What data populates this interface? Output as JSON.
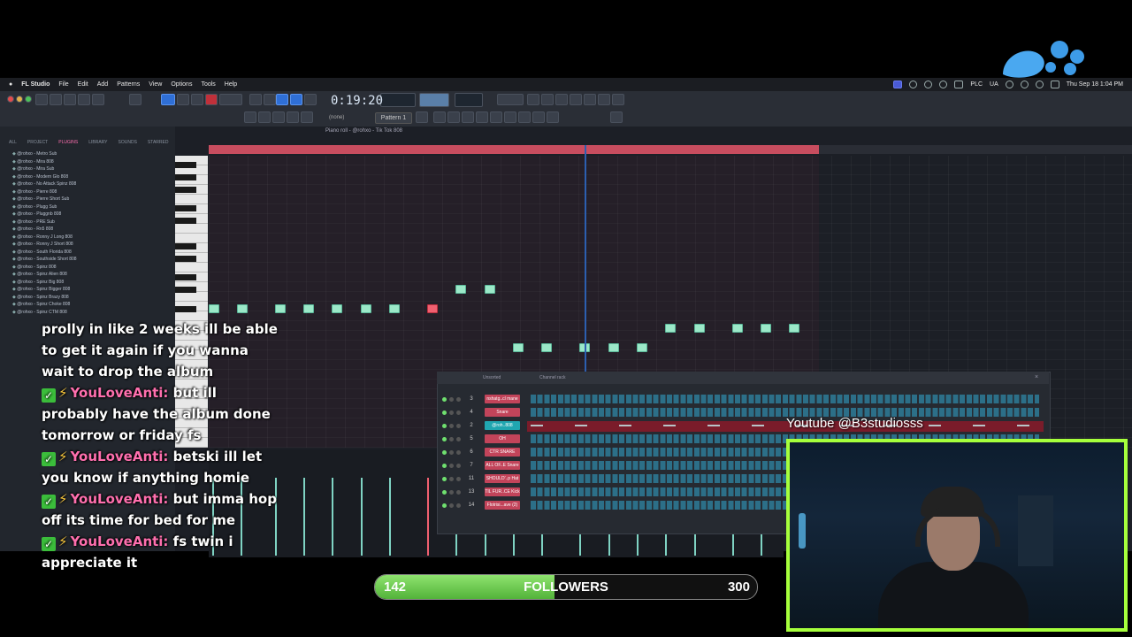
{
  "menubar": {
    "items": [
      "FL Studio",
      "File",
      "Edit",
      "Add",
      "Patterns",
      "View",
      "Options",
      "Tools",
      "Help"
    ],
    "status_right": [
      "PLC",
      "UA"
    ],
    "clock": "Thu Sep 18  1:04 PM"
  },
  "toolbar": {
    "time": "0:19:20",
    "pattern_label": "Pattern 1",
    "mode_label": "(none)"
  },
  "browser": {
    "tabs": [
      "ALL",
      "PROJECT",
      "PLUGINS",
      "LIBRARY",
      "SOUNDS",
      "STARRED"
    ],
    "active_tab": "PLUGINS",
    "items": [
      "@rohxo - Metro Sub",
      "@rohxo - Mira 808",
      "@rohxo - Mira Sub",
      "@rohxo - Modern Glo 808",
      "@rohxo - No Attack Spinz 808",
      "@rohxo - Pierre 808",
      "@rohxo - Pierre Short Sub",
      "@rohxo - Plugg Sub",
      "@rohxo - Pluggnb 808",
      "@rohxo - PRE Sub",
      "@rohxo - Rn5 808",
      "@rohxo - Ronny J Long 808",
      "@rohxo - Ronny J Short 808",
      "@rohxo - South Florida 808",
      "@rohxo - Southside Short 808",
      "@rohxo - Spinz 808",
      "@rohxo - Spinz Alien 808",
      "@rohxo - Spinz Big 808",
      "@rohxo - Spinz Bigger 808",
      "@rohxo - Spinz Brazy 808",
      "@rohxo - Spinz Choke 808",
      "@rohxo - Spinz CTM 808"
    ]
  },
  "piano_roll": {
    "title": "Piano roll - @rohxo - Tik Tok 808"
  },
  "channel_rack": {
    "title": "Channel rack",
    "filter": "Unsorted",
    "channels": [
      {
        "num": "3",
        "name": "nshatg..cl mane"
      },
      {
        "num": "4",
        "name": "Snare"
      },
      {
        "num": "2",
        "name": "@roh..808"
      },
      {
        "num": "5",
        "name": "OH"
      },
      {
        "num": "6",
        "name": "CTR SNARE"
      },
      {
        "num": "7",
        "name": "ALL OF..E Snare"
      },
      {
        "num": "11",
        "name": "SHOULD'..p Hat"
      },
      {
        "num": "13",
        "name": "TIL FUR..CE Kick"
      },
      {
        "num": "14",
        "name": "Flotrisi...ave (2)"
      }
    ]
  },
  "chat": [
    {
      "user": "",
      "message": "prolly in like 2 weeks ill be able to get it again if you wanna wait to drop the album"
    },
    {
      "user": "YouLoveAnti:",
      "message": "but ill probably have the album done tomorrow or friday fs"
    },
    {
      "user": "YouLoveAnti:",
      "message": "betski ill let you know if anything homie"
    },
    {
      "user": "YouLoveAnti:",
      "message": "but imma hop off its time for bed for me"
    },
    {
      "user": "YouLoveAnti:",
      "message": "fs twin i appreciate it"
    }
  ],
  "followers": {
    "current": "142",
    "label": "FOLLOWERS",
    "goal": "300",
    "progress": 0.47
  },
  "webcam": {
    "caption": "Youtube @B3studiosss"
  },
  "colors": {
    "accent_green": "#a6ff3c",
    "chat_name": "#ff6fae",
    "note": "#9be8c8"
  }
}
